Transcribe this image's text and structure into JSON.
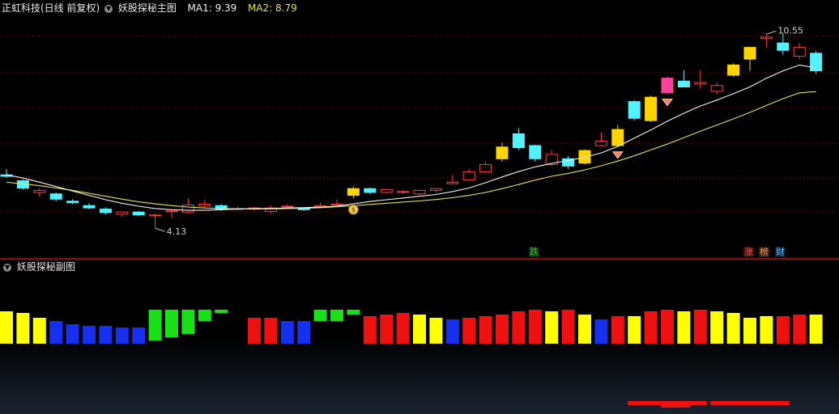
{
  "header": {
    "stock_label": "正虹科技(日线 前复权)",
    "main_indicator": "妖股探秘主图",
    "ma1_label": "MA1: 9.39",
    "ma2_label": "MA2: 8.79"
  },
  "sub_header": {
    "indicator": "妖股探秘副图"
  },
  "colors": {
    "bg": "#000000",
    "grid": "#8a1010",
    "up": "#ff3b3b",
    "up_strong": "#ffd400",
    "down": "#54f2ff",
    "pink": "#ff3f9c",
    "ma1": "#f2f2f2",
    "ma2": "#e8e050",
    "yellow": "#ffff00",
    "red": "#ee1111",
    "blue": "#1530ee",
    "green": "#19e019"
  },
  "icons": {
    "money_bag": "money-bag-icon",
    "gem": "diamond-icon",
    "dropdown": "chevron-down-icon"
  },
  "tags": {
    "die": "跌",
    "zhang": "涨",
    "bang": "榜",
    "cai": "财"
  },
  "chart_data": [
    {
      "type": "candlestick",
      "title": "妖股探秘主图",
      "ylim": [
        3.5,
        11.2
      ],
      "annotations": {
        "high_label": "10.55",
        "low_label": "4.13"
      },
      "candles": [
        {
          "o": 5.95,
          "h": 6.15,
          "l": 5.85,
          "c": 5.9,
          "s": "down"
        },
        {
          "o": 5.75,
          "h": 5.8,
          "l": 5.45,
          "c": 5.5,
          "s": "down"
        },
        {
          "o": 5.35,
          "h": 5.5,
          "l": 5.2,
          "c": 5.42,
          "s": "up"
        },
        {
          "o": 5.3,
          "h": 5.35,
          "l": 5.05,
          "c": 5.12,
          "s": "down"
        },
        {
          "o": 5.05,
          "h": 5.12,
          "l": 4.95,
          "c": 5.0,
          "s": "down"
        },
        {
          "o": 4.9,
          "h": 4.98,
          "l": 4.78,
          "c": 4.82,
          "s": "down"
        },
        {
          "o": 4.78,
          "h": 4.84,
          "l": 4.6,
          "c": 4.66,
          "s": "down"
        },
        {
          "o": 4.6,
          "h": 4.7,
          "l": 4.52,
          "c": 4.68,
          "s": "up"
        },
        {
          "o": 4.68,
          "h": 4.72,
          "l": 4.55,
          "c": 4.58,
          "s": "down"
        },
        {
          "o": 4.55,
          "h": 4.62,
          "l": 4.13,
          "c": 4.58,
          "s": "up"
        },
        {
          "o": 4.72,
          "h": 4.75,
          "l": 4.48,
          "c": 4.72,
          "s": "up"
        },
        {
          "o": 4.68,
          "h": 5.15,
          "l": 4.62,
          "c": 4.92,
          "s": "up"
        },
        {
          "o": 4.88,
          "h": 5.1,
          "l": 4.82,
          "c": 4.95,
          "s": "up"
        },
        {
          "o": 4.9,
          "h": 4.95,
          "l": 4.72,
          "c": 4.77,
          "s": "down"
        },
        {
          "o": 4.8,
          "h": 4.86,
          "l": 4.74,
          "c": 4.8,
          "s": "up"
        },
        {
          "o": 4.78,
          "h": 4.86,
          "l": 4.72,
          "c": 4.82,
          "s": "up"
        },
        {
          "o": 4.82,
          "h": 4.9,
          "l": 4.62,
          "c": 4.7,
          "s": "up"
        },
        {
          "o": 4.88,
          "h": 4.95,
          "l": 4.82,
          "c": 4.88,
          "s": "up"
        },
        {
          "o": 4.8,
          "h": 4.84,
          "l": 4.72,
          "c": 4.76,
          "s": "down"
        },
        {
          "o": 4.86,
          "h": 5.0,
          "l": 4.82,
          "c": 4.9,
          "s": "up"
        },
        {
          "o": 4.95,
          "h": 5.1,
          "l": 4.88,
          "c": 4.92,
          "s": "up"
        },
        {
          "o": 5.25,
          "h": 5.55,
          "l": 5.15,
          "c": 5.48,
          "s": "up_strong"
        },
        {
          "o": 5.48,
          "h": 5.52,
          "l": 5.3,
          "c": 5.35,
          "s": "down"
        },
        {
          "o": 5.35,
          "h": 5.48,
          "l": 5.32,
          "c": 5.45,
          "s": "up"
        },
        {
          "o": 5.38,
          "h": 5.42,
          "l": 5.3,
          "c": 5.38,
          "s": "up"
        },
        {
          "o": 5.3,
          "h": 5.45,
          "l": 5.25,
          "c": 5.42,
          "s": "up"
        },
        {
          "o": 5.42,
          "h": 5.5,
          "l": 5.36,
          "c": 5.48,
          "s": "up"
        },
        {
          "o": 5.65,
          "h": 5.95,
          "l": 5.62,
          "c": 5.7,
          "s": "up"
        },
        {
          "o": 5.78,
          "h": 6.15,
          "l": 5.75,
          "c": 6.05,
          "s": "up"
        },
        {
          "o": 6.05,
          "h": 6.4,
          "l": 6.0,
          "c": 6.3,
          "s": "up"
        },
        {
          "o": 6.5,
          "h": 7.05,
          "l": 6.4,
          "c": 6.9,
          "s": "up_strong"
        },
        {
          "o": 7.35,
          "h": 7.55,
          "l": 6.8,
          "c": 6.88,
          "s": "down"
        },
        {
          "o": 6.95,
          "h": 6.98,
          "l": 6.4,
          "c": 6.5,
          "s": "down"
        },
        {
          "o": 6.3,
          "h": 6.8,
          "l": 6.25,
          "c": 6.65,
          "s": "up"
        },
        {
          "o": 6.5,
          "h": 6.6,
          "l": 6.15,
          "c": 6.25,
          "s": "down"
        },
        {
          "o": 6.35,
          "h": 6.82,
          "l": 6.3,
          "c": 6.78,
          "s": "up_strong"
        },
        {
          "o": 6.95,
          "h": 7.4,
          "l": 6.92,
          "c": 7.1,
          "s": "up"
        },
        {
          "o": 6.95,
          "h": 7.65,
          "l": 6.9,
          "c": 7.5,
          "s": "up_strong"
        },
        {
          "o": 8.45,
          "h": 8.5,
          "l": 7.8,
          "c": 7.88,
          "s": "down"
        },
        {
          "o": 7.8,
          "h": 8.65,
          "l": 7.75,
          "c": 8.6,
          "s": "up_strong"
        },
        {
          "o": 8.75,
          "h": 9.3,
          "l": 8.7,
          "c": 9.25,
          "s": "pink"
        },
        {
          "o": 9.15,
          "h": 9.52,
          "l": 8.95,
          "c": 8.95,
          "s": "down"
        },
        {
          "o": 9.05,
          "h": 9.52,
          "l": 8.9,
          "c": 9.1,
          "s": "up"
        },
        {
          "o": 8.8,
          "h": 9.1,
          "l": 8.7,
          "c": 9.0,
          "s": "up"
        },
        {
          "o": 9.35,
          "h": 9.75,
          "l": 9.3,
          "c": 9.7,
          "s": "up_strong"
        },
        {
          "o": 9.9,
          "h": 10.3,
          "l": 9.5,
          "c": 10.3,
          "s": "up_strong"
        },
        {
          "o": 10.6,
          "h": 10.75,
          "l": 10.3,
          "c": 10.65,
          "s": "up"
        },
        {
          "o": 10.45,
          "h": 10.8,
          "l": 10.05,
          "c": 10.2,
          "s": "down"
        },
        {
          "o": 10.0,
          "h": 10.45,
          "l": 9.9,
          "c": 10.3,
          "s": "up"
        },
        {
          "o": 10.1,
          "h": 10.18,
          "l": 9.4,
          "c": 9.5,
          "s": "down"
        }
      ],
      "ma1": [
        5.95,
        5.84,
        5.7,
        5.55,
        5.4,
        5.25,
        5.1,
        4.98,
        4.88,
        4.8,
        4.76,
        4.74,
        4.74,
        4.76,
        4.78,
        4.8,
        4.8,
        4.82,
        4.83,
        4.85,
        4.88,
        4.96,
        5.04,
        5.1,
        5.16,
        5.22,
        5.28,
        5.38,
        5.5,
        5.68,
        5.88,
        6.06,
        6.22,
        6.34,
        6.44,
        6.55,
        6.7,
        6.92,
        7.2,
        7.48,
        7.78,
        8.05,
        8.3,
        8.5,
        8.72,
        8.95,
        9.25,
        9.5,
        9.7,
        9.6
      ],
      "ma2": [
        5.7,
        5.64,
        5.58,
        5.5,
        5.42,
        5.32,
        5.22,
        5.12,
        5.03,
        4.96,
        4.9,
        4.85,
        4.82,
        4.8,
        4.79,
        4.79,
        4.79,
        4.8,
        4.81,
        4.83,
        4.86,
        4.9,
        4.94,
        4.98,
        5.02,
        5.06,
        5.11,
        5.17,
        5.25,
        5.35,
        5.48,
        5.62,
        5.77,
        5.9,
        6.0,
        6.12,
        6.26,
        6.42,
        6.6,
        6.8,
        7.0,
        7.22,
        7.44,
        7.65,
        7.86,
        8.08,
        8.32,
        8.55,
        8.75,
        8.79
      ]
    },
    {
      "type": "bar",
      "title": "妖股探秘副图",
      "ylim": [
        -8,
        3
      ],
      "bars": [
        {
          "v": 2.0,
          "c": "yellow"
        },
        {
          "v": 1.9,
          "c": "yellow"
        },
        {
          "v": 1.6,
          "c": "yellow"
        },
        {
          "v": 1.4,
          "c": "blue"
        },
        {
          "v": 1.2,
          "c": "blue"
        },
        {
          "v": 1.1,
          "c": "blue"
        },
        {
          "v": 1.1,
          "c": "blue"
        },
        {
          "v": 1.0,
          "c": "blue"
        },
        {
          "v": 1.0,
          "c": "blue"
        },
        {
          "v": 1.9,
          "c": "green"
        },
        {
          "v": 1.7,
          "c": "green"
        },
        {
          "v": 1.5,
          "c": "green"
        },
        {
          "v": 0.7,
          "c": "green"
        },
        {
          "v": 0.2,
          "c": "green"
        },
        {
          "v": 0.0,
          "c": "none"
        },
        {
          "v": 1.6,
          "c": "red"
        },
        {
          "v": 1.6,
          "c": "red"
        },
        {
          "v": 1.4,
          "c": "blue"
        },
        {
          "v": 1.4,
          "c": "blue"
        },
        {
          "v": 0.7,
          "c": "green"
        },
        {
          "v": 0.7,
          "c": "green"
        },
        {
          "v": 0.3,
          "c": "green"
        },
        {
          "v": 1.7,
          "c": "red"
        },
        {
          "v": 1.8,
          "c": "red"
        },
        {
          "v": 1.9,
          "c": "red"
        },
        {
          "v": 1.8,
          "c": "yellow"
        },
        {
          "v": 1.6,
          "c": "yellow"
        },
        {
          "v": 1.5,
          "c": "blue"
        },
        {
          "v": 1.6,
          "c": "red"
        },
        {
          "v": 1.7,
          "c": "red"
        },
        {
          "v": 1.8,
          "c": "red"
        },
        {
          "v": 2.0,
          "c": "red"
        },
        {
          "v": 2.1,
          "c": "red"
        },
        {
          "v": 2.0,
          "c": "yellow"
        },
        {
          "v": 2.1,
          "c": "red"
        },
        {
          "v": 1.8,
          "c": "yellow"
        },
        {
          "v": 1.5,
          "c": "blue"
        },
        {
          "v": 1.7,
          "c": "red"
        },
        {
          "v": 1.7,
          "c": "yellow"
        },
        {
          "v": 2.0,
          "c": "red"
        },
        {
          "v": 2.1,
          "c": "red"
        },
        {
          "v": 2.0,
          "c": "yellow"
        },
        {
          "v": 2.1,
          "c": "red"
        },
        {
          "v": 2.0,
          "c": "yellow"
        },
        {
          "v": 1.9,
          "c": "yellow"
        },
        {
          "v": 1.6,
          "c": "yellow"
        },
        {
          "v": 1.7,
          "c": "yellow"
        },
        {
          "v": 1.7,
          "c": "red"
        },
        {
          "v": 1.8,
          "c": "red"
        },
        {
          "v": 1.8,
          "c": "yellow"
        }
      ],
      "signal_lines": [
        {
          "from_bar": 38,
          "to_bar": 42,
          "v": -7.0
        },
        {
          "from_bar": 40,
          "to_bar": 41,
          "v": -7.3
        },
        {
          "from_bar": 43,
          "to_bar": 47,
          "v": -7.0
        }
      ]
    }
  ]
}
